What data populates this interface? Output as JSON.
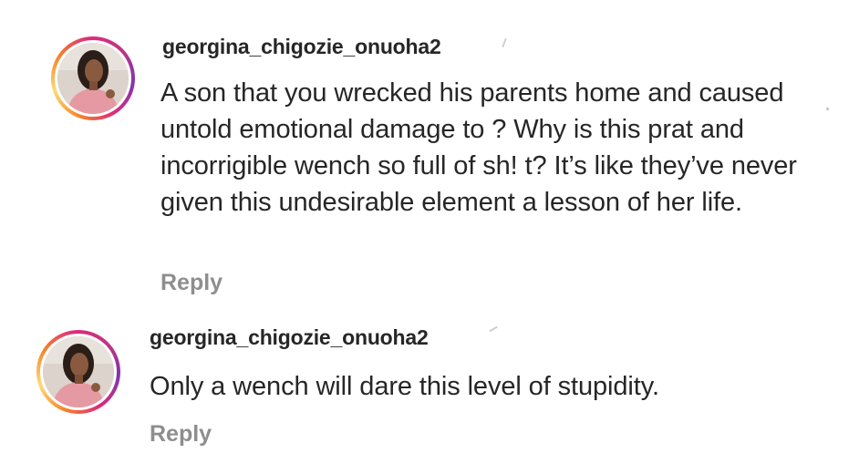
{
  "comments": [
    {
      "username": "georgina_chigozie_onuoha2",
      "text": "A son that you wrecked his parents home and caused untold emotional damage to ? Why is this prat and incorrigible wench so full of sh! t? It’s like they’ve never given this undesirable element a lesson of her life.",
      "reply_label": "Reply",
      "avatar_icon": "profile-photo"
    },
    {
      "username": "georgina_chigozie_onuoha2",
      "text": "Only a wench will dare this level of stupidity.",
      "reply_label": "Reply",
      "avatar_icon": "profile-photo"
    }
  ],
  "colors": {
    "text": "#262626",
    "reply": "#8e8e8e",
    "story_ring_start": "#f58529",
    "story_ring_end": "#dd2a7b"
  }
}
